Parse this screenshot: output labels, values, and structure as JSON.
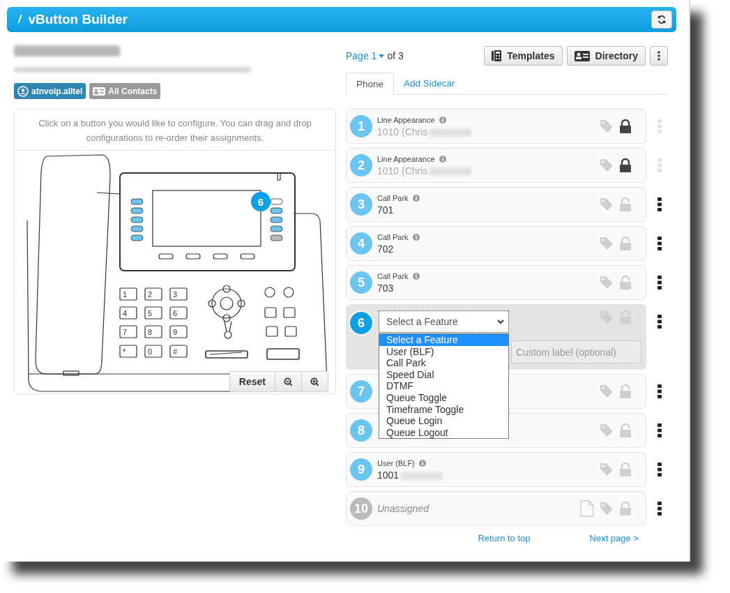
{
  "header": {
    "prefix": "/",
    "title": "vButton Builder"
  },
  "tags": [
    {
      "kind": "account",
      "label": "atnvoip.alltel"
    },
    {
      "kind": "contacts",
      "label": "All Contacts"
    }
  ],
  "instructions": "Click on a button you would like to configure. You can drag and drop configurations to re-order their assignments.",
  "phone": {
    "keys": [
      "1",
      "2",
      "3",
      "4",
      "5",
      "6",
      "7",
      "8",
      "9",
      "*",
      "0",
      "#"
    ],
    "badge": "6"
  },
  "zoom_controls": {
    "reset": "Reset"
  },
  "pagination": {
    "page": "Page 1",
    "total": "of 3"
  },
  "toolbar": [
    {
      "kind": "templates",
      "label": "Templates"
    },
    {
      "kind": "directory",
      "label": "Directory"
    },
    {
      "kind": "more"
    }
  ],
  "tabs": [
    {
      "label": "Phone",
      "selected": true
    },
    {
      "label": "Add Sidecar",
      "selected": false
    }
  ],
  "buttons": [
    {
      "number": "1",
      "kind": "assigned",
      "feature": "Line Appearance",
      "value": "1010 (Chris",
      "redacted": true,
      "locked": true
    },
    {
      "number": "2",
      "kind": "assigned",
      "feature": "Line Appearance",
      "value": "1010 (Chris",
      "redacted": true,
      "locked": true
    },
    {
      "number": "3",
      "kind": "assigned",
      "feature": "Call Park",
      "value": "701",
      "redacted": false,
      "locked": false
    },
    {
      "number": "4",
      "kind": "assigned",
      "feature": "Call Park",
      "value": "702",
      "redacted": false,
      "locked": false
    },
    {
      "number": "5",
      "kind": "assigned",
      "feature": "Call Park",
      "value": "703",
      "redacted": false,
      "locked": false
    },
    {
      "number": "6",
      "kind": "editing",
      "select": "Select a Feature",
      "custom_label_placeholder": "Custom label (optional)",
      "locked": false,
      "options": [
        {
          "label": "Select a Feature",
          "selected": true
        },
        {
          "label": "User (BLF)",
          "selected": false
        },
        {
          "label": "Call Park",
          "selected": false
        },
        {
          "label": "Speed Dial",
          "selected": false
        },
        {
          "label": "DTMF",
          "selected": false
        },
        {
          "label": "Queue Toggle",
          "selected": false
        },
        {
          "label": "Timeframe Toggle",
          "selected": false
        },
        {
          "label": "Queue Login",
          "selected": false
        },
        {
          "label": "Queue Logout",
          "selected": false
        }
      ]
    },
    {
      "number": "7",
      "kind": "covered",
      "locked": false
    },
    {
      "number": "8",
      "kind": "covered",
      "locked": false
    },
    {
      "number": "9",
      "kind": "assigned",
      "feature": "User (BLF)",
      "value": "1001",
      "redacted": true,
      "locked": false
    },
    {
      "number": "10",
      "kind": "unassigned",
      "value": "Unassigned",
      "locked": false
    }
  ],
  "footer_links": [
    "Return to top",
    "Next page >"
  ]
}
